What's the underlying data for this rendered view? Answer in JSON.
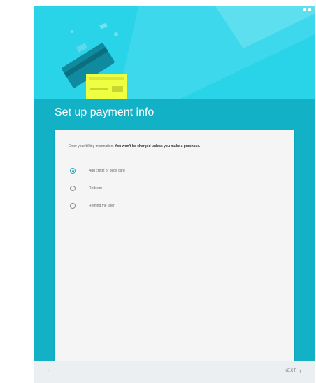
{
  "header": {
    "title": "Set up payment info"
  },
  "card": {
    "intro_text": "Enter your billing information. ",
    "intro_bold": "You won't be charged unless you make a purchase.",
    "options": [
      {
        "label": "Add credit or debit card",
        "selected": true
      },
      {
        "label": "Redeem",
        "selected": false
      },
      {
        "label": "Remind me later",
        "selected": false
      }
    ]
  },
  "footer": {
    "back_icon": "chevron-left-icon",
    "next_label": "NEXT",
    "next_icon": "chevron-right-icon"
  },
  "colors": {
    "hero": "#29D3E8",
    "band": "#12B1C6",
    "card": "#f5f5f5",
    "accent": "#26A9B9",
    "card_illustration_yellow": "#EEFF41",
    "bottom_bar": "#eceff1"
  },
  "icons": {
    "status": [
      "signal-icon",
      "battery-icon"
    ],
    "illustration": "payment-card-illustration"
  }
}
